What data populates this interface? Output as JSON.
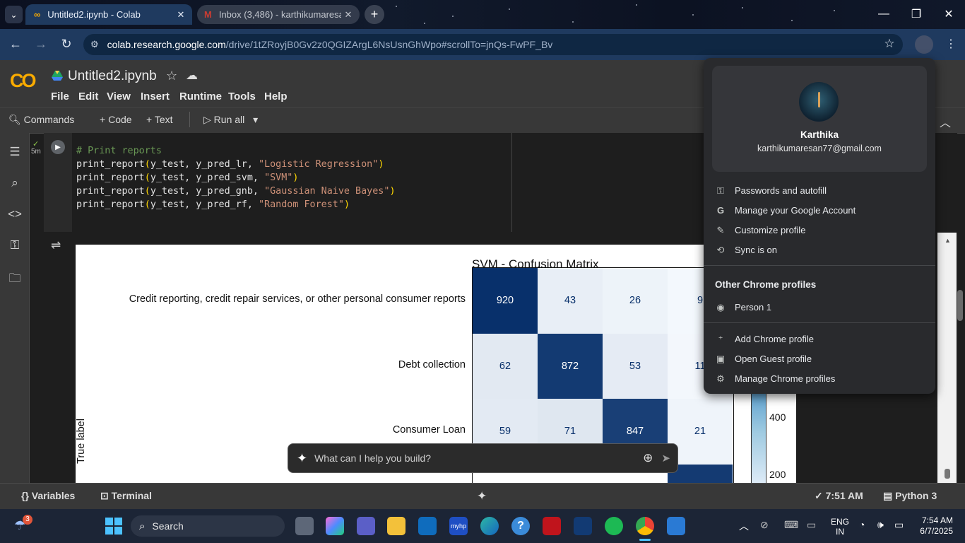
{
  "browser": {
    "tabs": [
      {
        "title": "Untitled2.ipynb - Colab",
        "active": true
      },
      {
        "title": "Inbox (3,486) - karthikumaresan",
        "active": false
      }
    ],
    "url_host": "colab.research.google.com",
    "url_path": "/drive/1tZRoyjB0Gv2z0QGIZArgL6NsUsnGhWpo#scrollTo=jnQs-FwPF_Bv"
  },
  "colab": {
    "logo": "CO",
    "notebook_name": "Untitled2.ipynb",
    "menus": [
      "File",
      "Edit",
      "View",
      "Insert",
      "Runtime",
      "Tools",
      "Help"
    ],
    "toolbar": {
      "commands": "Commands",
      "code": "Code",
      "text": "Text",
      "run_all": "Run all"
    },
    "cell": {
      "exec_time": "5m",
      "lines": [
        {
          "type": "comment",
          "text": "# Print reports"
        },
        {
          "fn": "print_report",
          "args": "y_test, y_pred_lr, ",
          "str": "\"Logistic Regression\""
        },
        {
          "fn": "print_report",
          "args": "y_test, y_pred_svm, ",
          "str": "\"SVM\""
        },
        {
          "fn": "print_report",
          "args": "y_test, y_pred_gnb, ",
          "str": "\"Gaussian Naive Bayes\""
        },
        {
          "fn": "print_report",
          "args": "y_test, y_pred_rf, ",
          "str": "\"Random Forest\""
        }
      ]
    },
    "status": {
      "variables": "Variables",
      "terminal": "Terminal",
      "time": "7:51 AM",
      "runtime": "Python 3"
    },
    "gemini_placeholder": "What can I help you build?"
  },
  "chart_data": {
    "type": "heatmap",
    "title": "SVM - Confusion Matrix",
    "ylabel": "True label",
    "row_labels": [
      "Credit reporting, credit repair services, or other personal consumer reports",
      "Debt collection",
      "Consumer Loan"
    ],
    "values": [
      [
        920,
        43,
        26,
        9
      ],
      [
        62,
        872,
        53,
        11
      ],
      [
        59,
        71,
        847,
        21
      ]
    ],
    "colorbar_ticks": [
      400,
      200
    ],
    "colormap": "Blues"
  },
  "profile_menu": {
    "name": "Karthika",
    "email": "karthikumaresan77@gmail.com",
    "items": [
      "Passwords and autofill",
      "Manage your Google Account",
      "Customize profile",
      "Sync is on"
    ],
    "other_header": "Other Chrome profiles",
    "other_profiles": [
      "Person 1"
    ],
    "footer_items": [
      "Add Chrome profile",
      "Open Guest profile",
      "Manage Chrome profiles"
    ]
  },
  "taskbar": {
    "weather_badge": "3",
    "search": "Search",
    "lang": "ENG",
    "region": "IN",
    "time": "7:54 AM",
    "date": "6/7/2025"
  }
}
